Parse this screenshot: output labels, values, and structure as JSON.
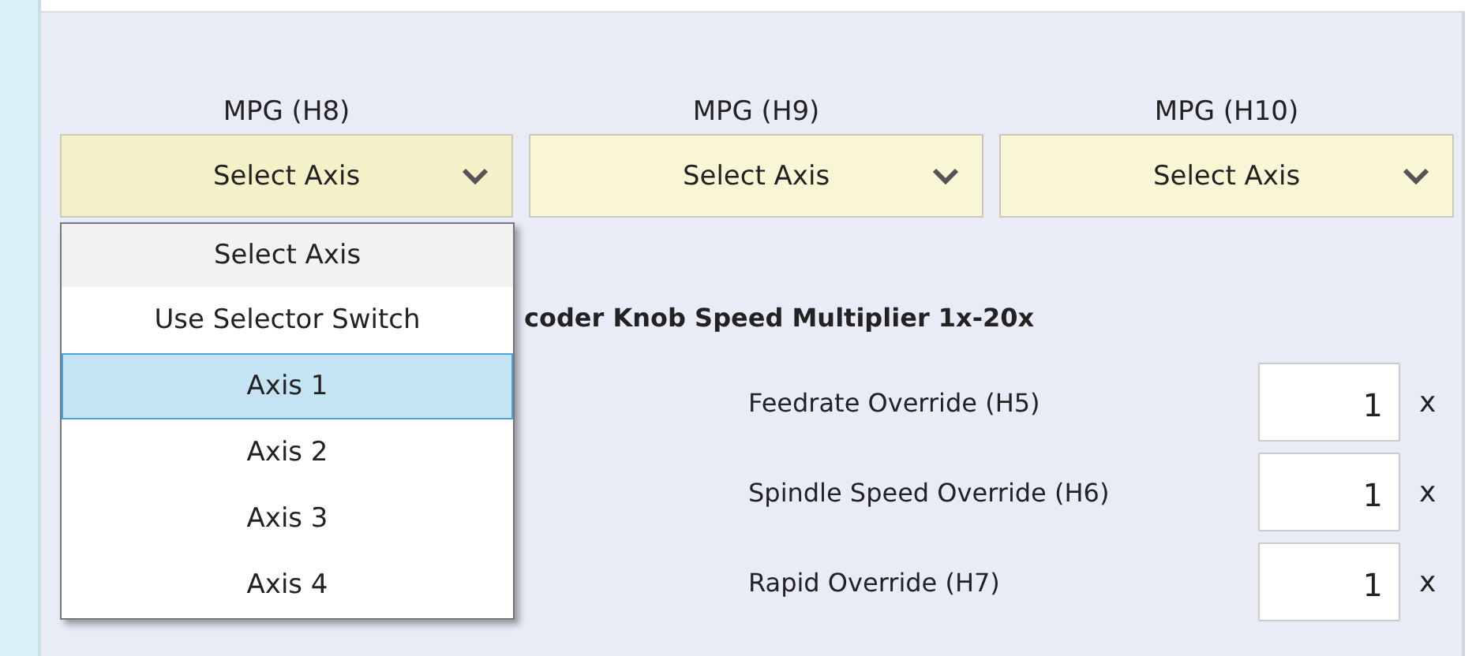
{
  "mpgs": [
    {
      "label": "MPG (H8)",
      "value": "Select Axis",
      "open": true
    },
    {
      "label": "MPG (H9)",
      "value": "Select Axis",
      "open": false
    },
    {
      "label": "MPG (H10)",
      "value": "Select Axis",
      "open": false
    }
  ],
  "dropdown_menu": {
    "header": "Select Axis",
    "items": [
      {
        "label": "Use Selector Switch",
        "selected": false
      },
      {
        "label": "Axis 1",
        "selected": true
      },
      {
        "label": "Axis 2",
        "selected": false
      },
      {
        "label": "Axis 3",
        "selected": false
      },
      {
        "label": "Axis 4",
        "selected": false
      }
    ]
  },
  "heading": "coder Knob Speed Multiplier 1x-20x",
  "overrides": [
    {
      "label": "Feedrate Override (H5)",
      "value": "1",
      "unit": "x"
    },
    {
      "label": "Spindle Speed Override (H6)",
      "value": "1",
      "unit": "x"
    },
    {
      "label": "Rapid Override (H7)",
      "value": "1",
      "unit": "x"
    }
  ]
}
